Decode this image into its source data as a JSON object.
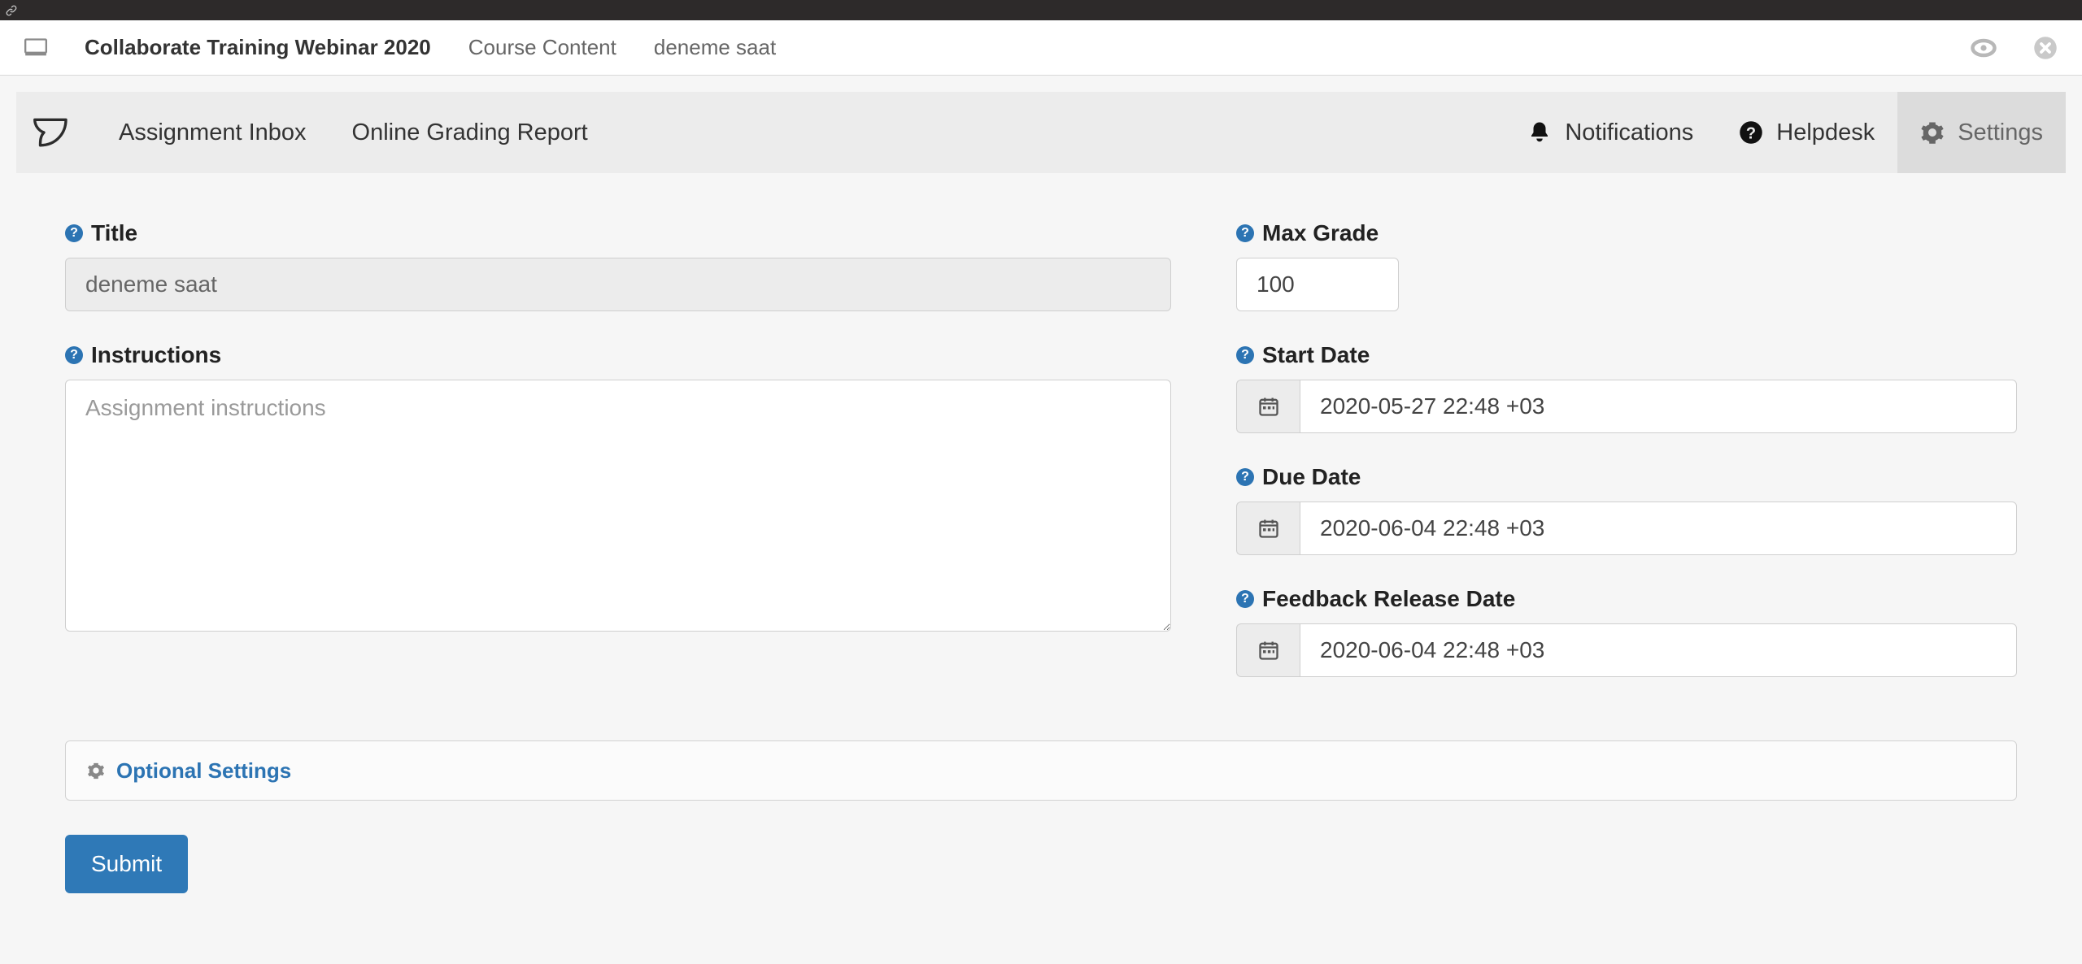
{
  "breadcrumb": {
    "course_title": "Collaborate Training Webinar 2020",
    "items": [
      "Course Content",
      "deneme saat"
    ]
  },
  "toolbar": {
    "links": [
      "Assignment Inbox",
      "Online Grading Report"
    ],
    "notifications_label": "Notifications",
    "helpdesk_label": "Helpdesk",
    "settings_label": "Settings"
  },
  "form": {
    "title_label": "Title",
    "title_value": "deneme saat",
    "instructions_label": "Instructions",
    "instructions_placeholder": "Assignment instructions",
    "instructions_value": "",
    "max_grade_label": "Max Grade",
    "max_grade_value": "100",
    "start_date_label": "Start Date",
    "start_date_value": "2020-05-27 22:48 +03",
    "due_date_label": "Due Date",
    "due_date_value": "2020-06-04 22:48 +03",
    "feedback_date_label": "Feedback Release Date",
    "feedback_date_value": "2020-06-04 22:48 +03"
  },
  "optional_settings_label": "Optional Settings",
  "submit_label": "Submit"
}
